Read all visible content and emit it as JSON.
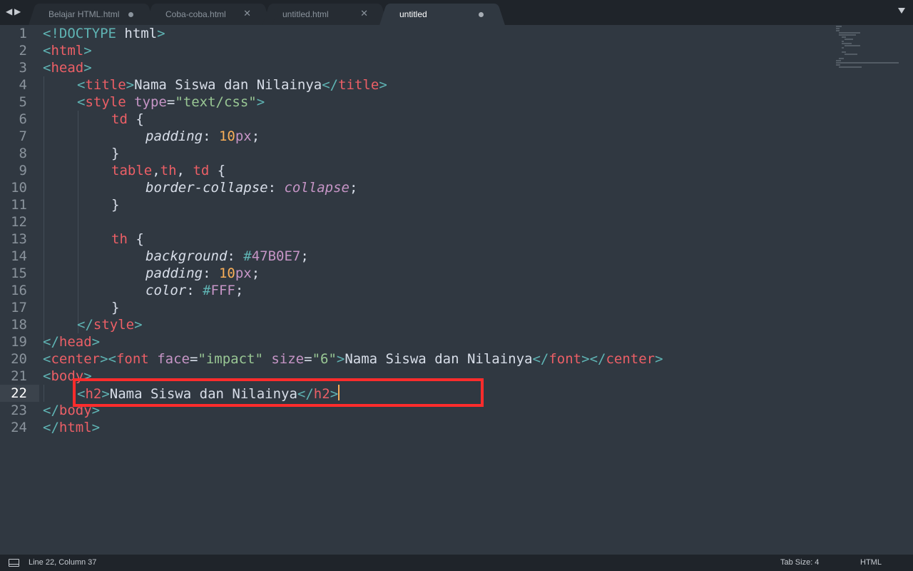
{
  "tabs": [
    {
      "label": "Belajar HTML.html",
      "control": "dirty",
      "active": false
    },
    {
      "label": "Coba-coba.html",
      "control": "close",
      "active": false
    },
    {
      "label": "untitled.html",
      "control": "close",
      "active": false
    },
    {
      "label": "untitled",
      "control": "dirty",
      "active": true
    }
  ],
  "nav": {
    "back_icon": "◀",
    "forward_icon": "▶"
  },
  "tab_close_glyph": "✕",
  "lines": [
    {
      "n": "1"
    },
    {
      "n": "2"
    },
    {
      "n": "3"
    },
    {
      "n": "4"
    },
    {
      "n": "5"
    },
    {
      "n": "6"
    },
    {
      "n": "7"
    },
    {
      "n": "8"
    },
    {
      "n": "9"
    },
    {
      "n": "10"
    },
    {
      "n": "11"
    },
    {
      "n": "12"
    },
    {
      "n": "13"
    },
    {
      "n": "14"
    },
    {
      "n": "15"
    },
    {
      "n": "16"
    },
    {
      "n": "17"
    },
    {
      "n": "18"
    },
    {
      "n": "19"
    },
    {
      "n": "20"
    },
    {
      "n": "21"
    },
    {
      "n": "22"
    },
    {
      "n": "23"
    },
    {
      "n": "24"
    }
  ],
  "code": {
    "l1": {
      "a": "<!DOCTYPE",
      "b": " html",
      "c": ">"
    },
    "l2": {
      "a": "<",
      "b": "html",
      "c": ">"
    },
    "l3": {
      "a": "<",
      "b": "head",
      "c": ">"
    },
    "l4": {
      "a": "<",
      "b": "title",
      "c": ">",
      "d": "Nama Siswa dan Nilainya",
      "e": "</",
      "f": "title",
      "g": ">"
    },
    "l5": {
      "a": "<",
      "b": "style",
      "c": " type",
      "d": "=",
      "e": "\"text/css\"",
      "f": ">"
    },
    "l6": {
      "a": "td",
      "b": " {"
    },
    "l7": {
      "a": "padding",
      "b": ": ",
      "c": "10",
      "d": "px",
      "e": ";"
    },
    "l8": {
      "a": "}"
    },
    "l9": {
      "a": "table",
      "b": ",",
      "c": "th",
      "d": ", ",
      "e": "td",
      "f": " {"
    },
    "l10": {
      "a": "border-collapse",
      "b": ": ",
      "c": "collapse",
      "d": ";"
    },
    "l11": {
      "a": "}"
    },
    "l13": {
      "a": "th",
      "b": " {"
    },
    "l14": {
      "a": "background",
      "b": ": ",
      "c": "#",
      "d": "47B0E7",
      "e": ";"
    },
    "l15": {
      "a": "padding",
      "b": ": ",
      "c": "10",
      "d": "px",
      "e": ";"
    },
    "l16": {
      "a": "color",
      "b": ": ",
      "c": "#",
      "d": "FFF",
      "e": ";"
    },
    "l17": {
      "a": "}"
    },
    "l18": {
      "a": "</",
      "b": "style",
      "c": ">"
    },
    "l19": {
      "a": "</",
      "b": "head",
      "c": ">"
    },
    "l20": {
      "a": "<",
      "b": "center",
      "c": "><",
      "d": "font",
      "e": " face",
      "f": "=",
      "g": "\"impact\"",
      "h": " size",
      "i": "=",
      "j": "\"6\"",
      "k": ">",
      "l": "Nama Siswa dan Nilainya",
      "m": "</",
      "n": "font",
      "o": "></",
      "p": "center",
      "q": ">"
    },
    "l21": {
      "a": "<",
      "b": "body",
      "c": ">"
    },
    "l22": {
      "a": "<",
      "b": "h2",
      "c": ">",
      "d": "Nama Siswa dan Nilainya",
      "e": "</",
      "f": "h2",
      "g": ">"
    },
    "l23": {
      "a": "</",
      "b": "body",
      "c": ">"
    },
    "l24": {
      "a": "</",
      "b": "html",
      "c": ">"
    }
  },
  "status": {
    "position": "Line 22, Column 37",
    "tab_size": "Tab Size: 4",
    "syntax": "HTML"
  },
  "colors": {
    "background": "#303841",
    "tag": "#ec5f66",
    "bracket": "#5fb4b4",
    "attribute": "#c695c6",
    "string": "#99c794",
    "number": "#f9ae58",
    "highlight_box": "#ff2c2c"
  },
  "icons": {
    "tab_list": "chevron-down-icon",
    "panel": "panel-toggle-icon"
  }
}
